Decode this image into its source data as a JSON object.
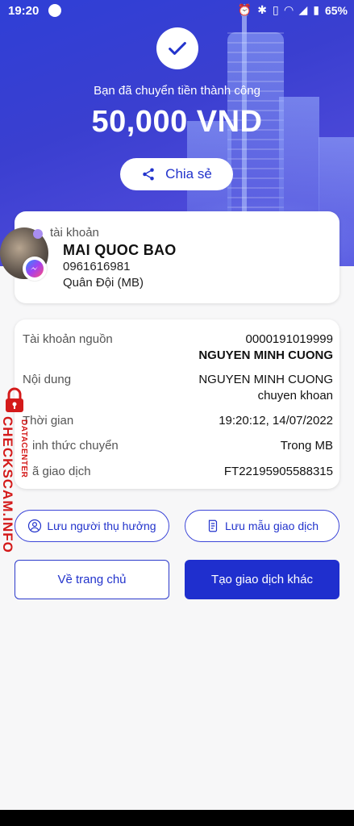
{
  "status_bar": {
    "time": "19:20",
    "battery": "65%"
  },
  "hero": {
    "subtitle": "Bạn đã chuyển tiền thành công",
    "amount": "50,000 VND",
    "share_label": "Chia sẻ"
  },
  "recipient": {
    "label": "tài khoản",
    "name": "MAI QUOC BAO",
    "account_number": "0961616981",
    "bank": "Quân Đội (MB)"
  },
  "details": {
    "source_label": "Tài khoản nguồn",
    "source_account": "0000191019999",
    "source_name": "NGUYEN MINH CUONG",
    "content_label": "Nội dung",
    "content_line1": "NGUYEN MINH CUONG",
    "content_line2": "chuyen khoan",
    "time_label": "Thời gian",
    "time_value": "19:20:12, 14/07/2022",
    "method_label": "inh thức chuyển",
    "method_value": "Trong MB",
    "txid_label": "ã giao dịch",
    "txid_value": "FT22195905588315"
  },
  "actions": {
    "save_beneficiary": "Lưu người thụ hưởng",
    "save_template": "Lưu mẫu giao dịch",
    "home": "Về trang chủ",
    "new_transaction": "Tạo giao dịch khác"
  },
  "watermark": {
    "main": "CHECKSCAM.INFO",
    "sub": "DATACENTER"
  },
  "icons": {
    "check": "check-icon",
    "share": "share-icon",
    "user": "user-icon",
    "receipt": "receipt-icon",
    "messenger": "messenger-icon"
  },
  "colors": {
    "primary": "#1f2fce",
    "hero": "#3a3fd0",
    "watermark": "#d41a1a"
  }
}
